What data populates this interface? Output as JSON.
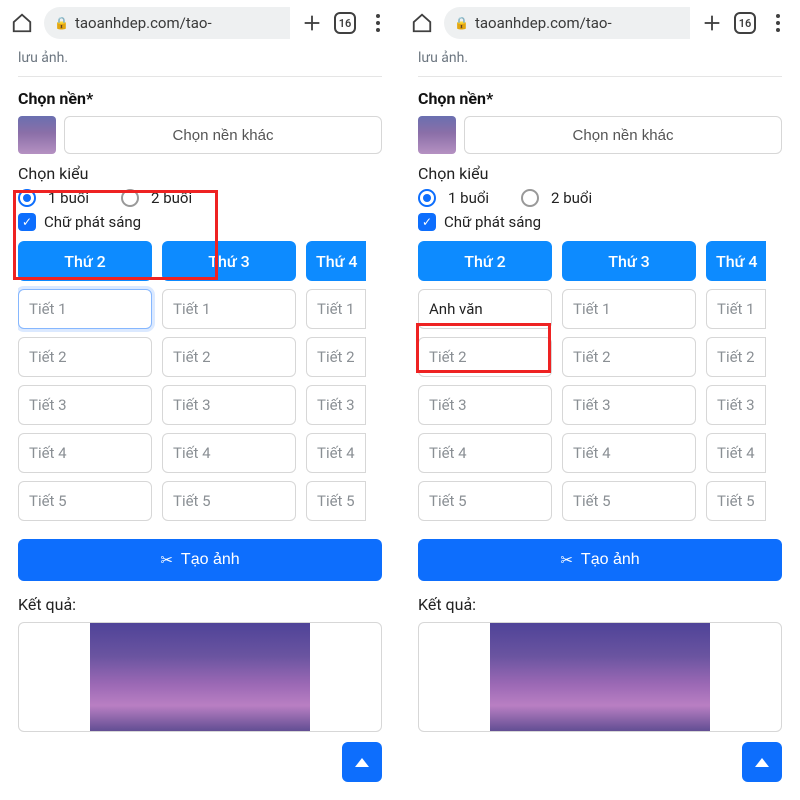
{
  "browser": {
    "url": "taoanhdep.com/tao-",
    "tab_count": "16"
  },
  "top_faded_text": "lưu ảnh.",
  "bg_section_title": "Chọn nền*",
  "bg_btn_label": "Chọn nền khác",
  "style_section_title": "Chọn kiểu",
  "radio_1": "1 buổi",
  "radio_2": "2 buổi",
  "checkbox_label": "Chữ phát sáng",
  "days": {
    "d0": "Thứ 2",
    "d1": "Thứ 3",
    "d2": "Thứ 4"
  },
  "placeholders": {
    "t1": "Tiết 1",
    "t2": "Tiết 2",
    "t3": "Tiết 3",
    "t4": "Tiết 4",
    "t5": "Tiết 5"
  },
  "entered_value": "Anh văn",
  "create_btn_label": "Tạo ảnh",
  "result_label": "Kết quả:"
}
